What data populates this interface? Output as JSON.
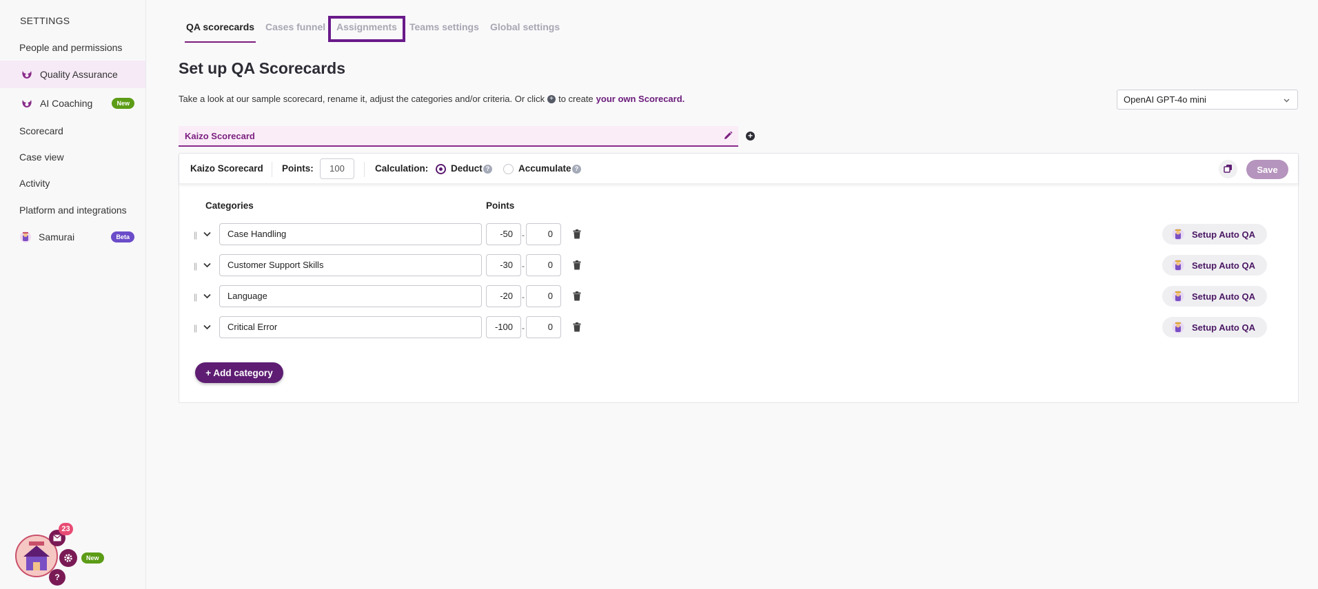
{
  "sidebar": {
    "heading": "SETTINGS",
    "items": [
      {
        "label": "People and permissions"
      },
      {
        "label": "Quality Assurance",
        "icon": "quality-assurance-icon"
      },
      {
        "label": "AI Coaching",
        "icon": "ai-coaching-icon",
        "badge": "New"
      },
      {
        "label": "Scorecard"
      },
      {
        "label": "Case view"
      },
      {
        "label": "Activity"
      },
      {
        "label": "Platform and integrations"
      },
      {
        "label": "Samurai",
        "icon": "samurai-icon",
        "badge": "Beta"
      }
    ]
  },
  "tabs": [
    {
      "label": "QA scorecards",
      "active": true
    },
    {
      "label": "Cases funnel"
    },
    {
      "label": "Assignments",
      "highlighted": true
    },
    {
      "label": "Teams settings"
    },
    {
      "label": "Global settings"
    }
  ],
  "page": {
    "title": "Set up QA Scorecards",
    "intro_before": "Take a look at our sample scorecard, rename it, adjust the categories and/or criteria. Or click",
    "intro_after": "to create",
    "intro_link": "your own Scorecard."
  },
  "model_select": {
    "value": "OpenAI GPT-4o mini"
  },
  "scorecard_name": "Kaizo Scorecard",
  "panel": {
    "name": "Kaizo Scorecard",
    "points_label": "Points:",
    "points_value": "100",
    "calculation_label": "Calculation:",
    "deduct_label": "Deduct",
    "accumulate_label": "Accumulate",
    "selected_calculation": "Deduct",
    "save_label": "Save",
    "categories_header": "Categories",
    "points_header": "Points",
    "categories": [
      {
        "name": "Case Handling",
        "min": "-50",
        "max": "0"
      },
      {
        "name": "Customer Support Skills",
        "min": "-30",
        "max": "0"
      },
      {
        "name": "Language",
        "min": "-20",
        "max": "0"
      },
      {
        "name": "Critical Error",
        "min": "-100",
        "max": "0"
      }
    ],
    "auto_qa_label": "Setup Auto QA",
    "add_category_label": "+ Add category"
  },
  "widget": {
    "count": "23",
    "help": "?",
    "badge": "New"
  },
  "colors": {
    "accent": "#7a1c7a",
    "primary_button": "#5e1d73",
    "save_button_disabled": "#b594bd",
    "badge_new": "#5c9c16",
    "badge_beta": "#6b4cc9"
  }
}
